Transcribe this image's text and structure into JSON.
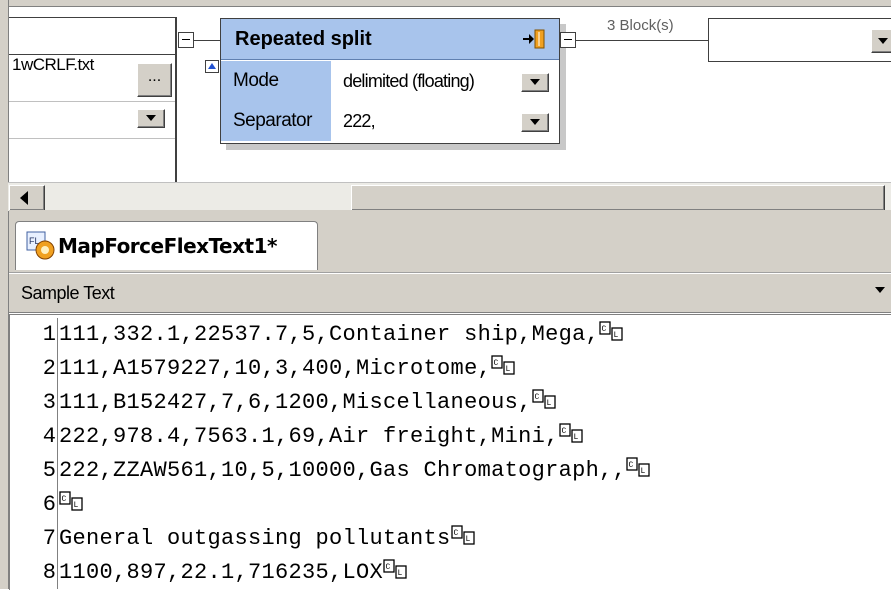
{
  "left_component": {
    "file_name": "1wCRLF.txt",
    "browse_label": "..."
  },
  "split_component": {
    "title": "Repeated split",
    "rows": [
      {
        "label": "Mode",
        "value": "delimited (floating)"
      },
      {
        "label": "Separator",
        "value": "222,"
      }
    ]
  },
  "connector_label": "3 Block(s)",
  "tab": {
    "label": "MapForceFlexText1*"
  },
  "sample_panel": {
    "title": "Sample Text"
  },
  "sample_lines": [
    {
      "n": "1",
      "text": "111,332.1,22537.7,5,Container ship,Mega,"
    },
    {
      "n": "2",
      "text": "111,A1579227,10,3,400,Microtome,"
    },
    {
      "n": "3",
      "text": "111,B152427,7,6,1200,Miscellaneous,"
    },
    {
      "n": "4",
      "text": "222,978.4,7563.1,69,Air freight,Mini,"
    },
    {
      "n": "5",
      "text": "222,ZZAW561,10,5,10000,Gas Chromatograph,,"
    },
    {
      "n": "6",
      "text": ""
    },
    {
      "n": "7",
      "text": "General outgassing pollutants"
    },
    {
      "n": "8",
      "text": "1100,897,22.1,716235,LOX"
    }
  ],
  "colors": {
    "header_blue": "#a8c4ec",
    "chrome": "#d4d0c8"
  },
  "icons": {
    "line_end": "crlf-icon",
    "split": "split-icon",
    "tab": "flextext-icon"
  }
}
